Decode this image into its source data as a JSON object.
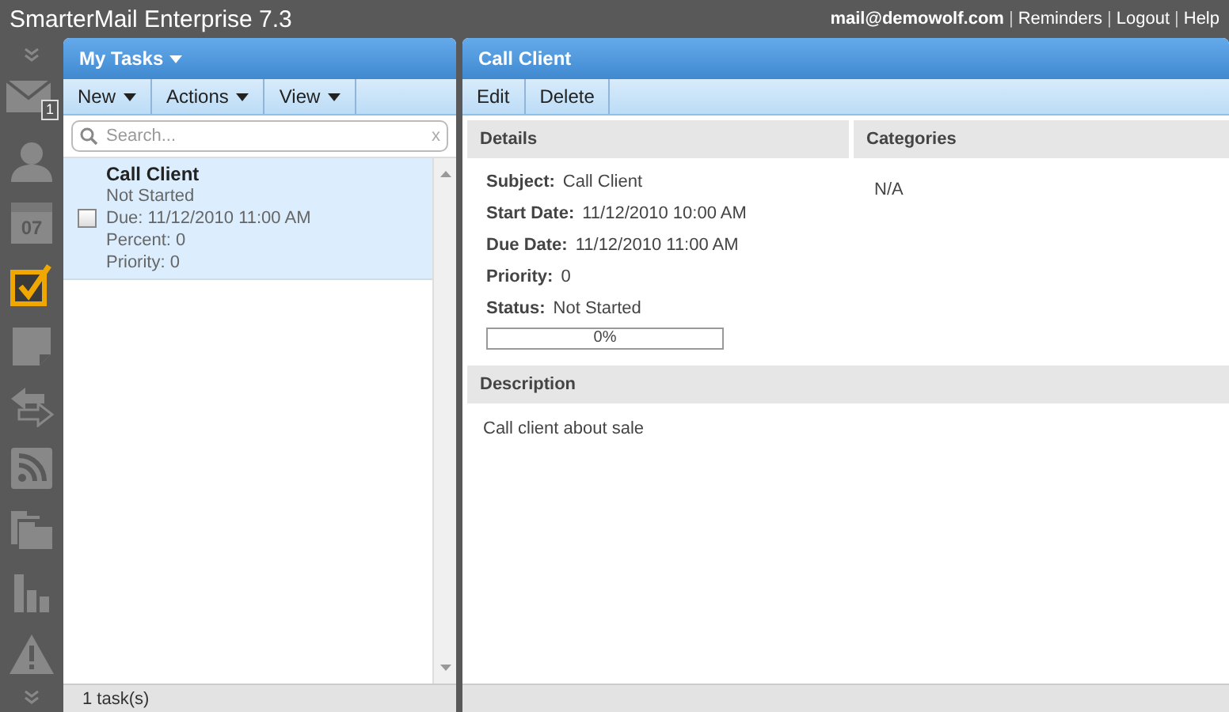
{
  "app_title": "SmarterMail Enterprise 7.3",
  "top_links": [
    "mail@demowolf.com",
    "Reminders",
    "Logout",
    "Help"
  ],
  "link_separator": "|",
  "sidebar": {
    "items": [
      {
        "kind": "collapse"
      },
      {
        "kind": "mail",
        "selected": false,
        "badge": "1"
      },
      {
        "kind": "contacts",
        "selected": false
      },
      {
        "kind": "calendar",
        "selected": false,
        "day": "07"
      },
      {
        "kind": "tasks",
        "selected": true
      },
      {
        "kind": "notes",
        "selected": false
      },
      {
        "kind": "sync",
        "selected": false
      },
      {
        "kind": "rss",
        "selected": false
      },
      {
        "kind": "files",
        "selected": false
      },
      {
        "kind": "reports",
        "selected": false
      },
      {
        "kind": "alerts",
        "selected": false
      },
      {
        "kind": "collapse"
      }
    ]
  },
  "task_list": {
    "title": "My Tasks",
    "toolbar": [
      "New",
      "Actions",
      "View"
    ],
    "search": {
      "placeholder": "Search...",
      "clear": "x"
    },
    "tasks": [
      {
        "title": "Call Client",
        "status": "Not Started",
        "due": "Due: 11/12/2010 11:00 AM",
        "percent": "Percent: 0",
        "priority": "Priority: 0",
        "checked": false,
        "selected": true
      }
    ],
    "footer": "1 task(s)"
  },
  "detail": {
    "title": "Call Client",
    "toolbar": [
      "Edit",
      "Delete"
    ],
    "details_heading": "Details",
    "categories_heading": "Categories",
    "fields": [
      {
        "label": "Subject:",
        "value": "Call Client"
      },
      {
        "label": "Start Date:",
        "value": "11/12/2010 10:00 AM"
      },
      {
        "label": "Due Date:",
        "value": "11/12/2010 11:00 AM"
      },
      {
        "label": "Priority:",
        "value": "0"
      },
      {
        "label": "Status:",
        "value": "Not Started"
      }
    ],
    "progress": {
      "level": 0,
      "reading": "0%"
    },
    "categories": [
      "N/A"
    ],
    "description_heading": "Description",
    "description": "Call client about sale"
  }
}
